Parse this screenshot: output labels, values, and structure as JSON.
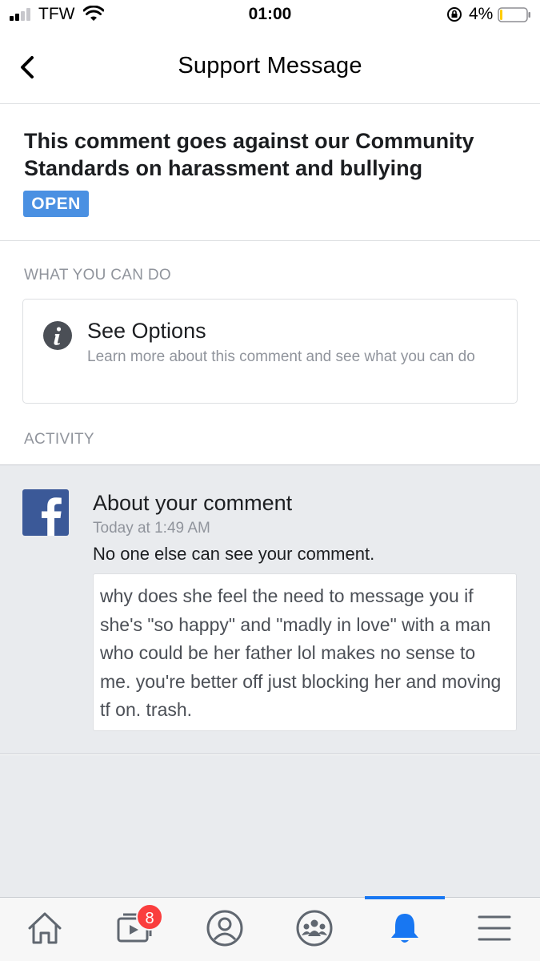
{
  "status_bar": {
    "carrier": "TFW",
    "time": "01:00",
    "battery_percent": "4%",
    "battery_level": 0.04,
    "signal_bars_filled": 2,
    "signal_bars_total": 4
  },
  "nav": {
    "title": "Support Message",
    "back_icon": "chevron-left-icon"
  },
  "header": {
    "headline": "This comment goes against our Community Standards on harassment and bullying",
    "status_badge": "OPEN",
    "badge_color": "#4a90e2"
  },
  "what_you_can_do": {
    "label": "WHAT YOU CAN DO",
    "option": {
      "icon": "info-icon",
      "title": "See Options",
      "description": "Learn more about this comment and see what you can do"
    }
  },
  "activity": {
    "label": "ACTIVITY",
    "item": {
      "icon": "facebook-logo-icon",
      "title": "About your comment",
      "time": "Today at 1:49 AM",
      "note": "No one else can see your comment.",
      "comment": "why does she feel the need to message you if she's \"so happy\" and \"madly in love\" with a man who could be her father lol makes no sense to me. you're better off just blocking her and moving tf on. trash."
    }
  },
  "tab_bar": {
    "tabs": [
      {
        "name": "home",
        "icon": "home-icon"
      },
      {
        "name": "watch",
        "icon": "video-icon",
        "badge": "8"
      },
      {
        "name": "profile",
        "icon": "profile-icon"
      },
      {
        "name": "groups",
        "icon": "groups-icon"
      },
      {
        "name": "notifications",
        "icon": "bell-icon",
        "active": true
      },
      {
        "name": "menu",
        "icon": "menu-icon"
      }
    ],
    "active_color": "#1877f2",
    "badge_color": "#fa3e3e"
  }
}
